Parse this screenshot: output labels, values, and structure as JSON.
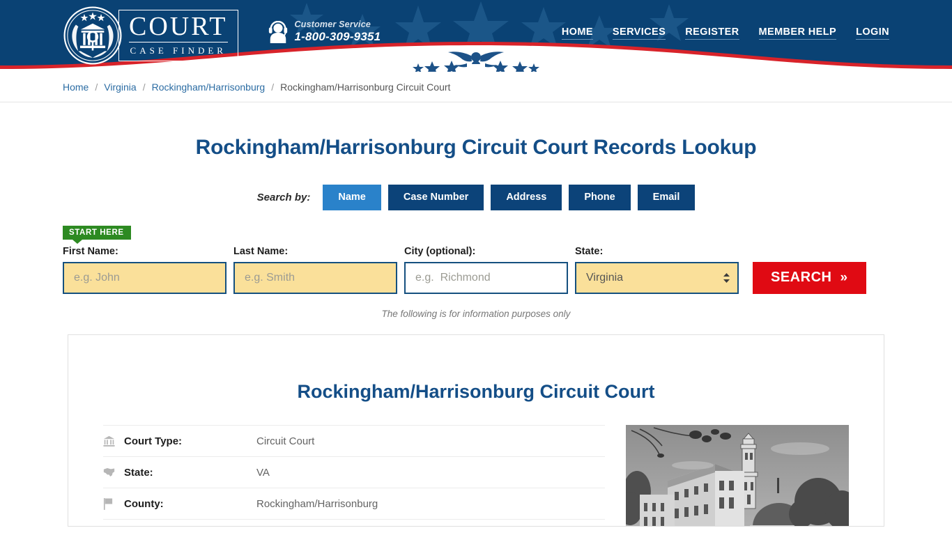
{
  "header": {
    "logo": {
      "main": "COURT",
      "sub": "CASE FINDER",
      "seal_icon": "court-seal-icon"
    },
    "customer_service": {
      "label": "Customer Service",
      "phone": "1-800-309-9351",
      "icon": "headset-support-icon"
    },
    "nav": [
      {
        "label": "HOME"
      },
      {
        "label": "SERVICES"
      },
      {
        "label": "REGISTER"
      },
      {
        "label": "MEMBER HELP"
      },
      {
        "label": "LOGIN"
      }
    ],
    "colors": {
      "navy": "#0a4274",
      "star": "#1b5688",
      "red": "#d8232a",
      "white": "#ffffff"
    }
  },
  "breadcrumb": {
    "items": [
      {
        "label": "Home",
        "link": true
      },
      {
        "label": "Virginia",
        "link": true
      },
      {
        "label": "Rockingham/Harrisonburg",
        "link": true
      },
      {
        "label": "Rockingham/Harrisonburg Circuit Court",
        "link": false
      }
    ],
    "separator": "/"
  },
  "search": {
    "page_title": "Rockingham/Harrisonburg Circuit Court Records Lookup",
    "search_by_label": "Search by:",
    "tabs": [
      {
        "label": "Name",
        "active": true
      },
      {
        "label": "Case Number",
        "active": false
      },
      {
        "label": "Address",
        "active": false
      },
      {
        "label": "Phone",
        "active": false
      },
      {
        "label": "Email",
        "active": false
      }
    ],
    "start_here_badge": "START HERE",
    "fields": {
      "first_name": {
        "label": "First Name:",
        "placeholder": "e.g. John",
        "value": ""
      },
      "last_name": {
        "label": "Last Name:",
        "placeholder": "e.g. Smith",
        "value": ""
      },
      "city": {
        "label": "City (optional):",
        "placeholder": "e.g.  Richmond",
        "value": ""
      },
      "state": {
        "label": "State:",
        "selected": "Virginia"
      }
    },
    "search_button": {
      "label": "SEARCH",
      "chevron": "»"
    },
    "disclaimer": "The following is for information purposes only",
    "colors": {
      "tab_active": "#2a82ca",
      "tab_inactive": "#0c4379",
      "input_highlight": "#fae09a",
      "input_border": "#15507f",
      "search_button": "#e00a13",
      "start_here": "#2d8a22",
      "title": "#144e87"
    }
  },
  "court_card": {
    "title": "Rockingham/Harrisonburg Circuit Court",
    "details": [
      {
        "icon": "bank-courthouse-icon",
        "label": "Court Type:",
        "value": "Circuit Court"
      },
      {
        "icon": "us-map-icon",
        "label": "State:",
        "value": "VA"
      },
      {
        "icon": "flag-icon",
        "label": "County:",
        "value": "Rockingham/Harrisonburg"
      }
    ],
    "photo_alt": "courthouse-photo"
  }
}
